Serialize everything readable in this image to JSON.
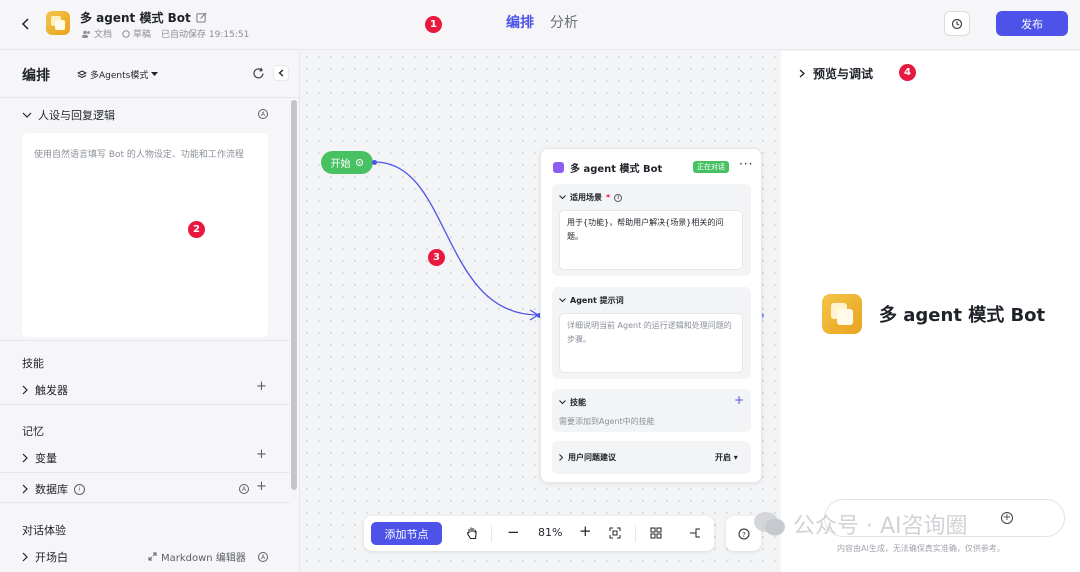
{
  "header": {
    "bot_title": "多 agent 模式 Bot",
    "meta_doc": "文档",
    "meta_draft": "草稿",
    "meta_saved": "已自动保存 19:15:51",
    "tab_arrange": "编排",
    "tab_analyze": "分析",
    "publish_label": "发布",
    "badge": "1"
  },
  "left_panel": {
    "title": "编排",
    "mode": "多Agents模式",
    "persona_title": "人设与回复逻辑",
    "persona_placeholder": "使用自然语言填写 Bot 的人物设定、功能和工作流程",
    "badge": "2",
    "skills_head": "技能",
    "trigger": "触发器",
    "memory_head": "记忆",
    "variables": "变量",
    "database": "数据库",
    "dialog_head": "对话体验",
    "opener": "开场白",
    "md_editor": "Markdown 编辑器"
  },
  "canvas": {
    "start_label": "开始",
    "badge": "3",
    "agent_title": "多 agent 模式 Bot",
    "status": "正在对话",
    "scene_title": "适用场景",
    "scene_text": "用于{功能}，帮助用户解决{场景}相关的问题。",
    "prompt_title": "Agent 提示词",
    "prompt_placeholder": "详细说明当前 Agent 的运行逻辑和处理问题的步骤。",
    "skills_title": "技能",
    "skills_hint": "需要添加到Agent中的技能",
    "suggest_title": "用户问题建议",
    "suggest_value": "开启"
  },
  "toolbar": {
    "add_node": "添加节点",
    "zoom": "81%"
  },
  "right_panel": {
    "title": "预览与调试",
    "badge": "4",
    "bot_name": "多 agent 模式 Bot",
    "disclaimer": "内容由AI生成，无法确保真实准确，仅供参考。"
  },
  "watermark": "公众号 · AI咨询圈",
  "colors": {
    "accent": "#4d53e8",
    "start_green": "#48c163",
    "badge_red": "#e8183e",
    "logo_gold": "#f4c64a"
  }
}
